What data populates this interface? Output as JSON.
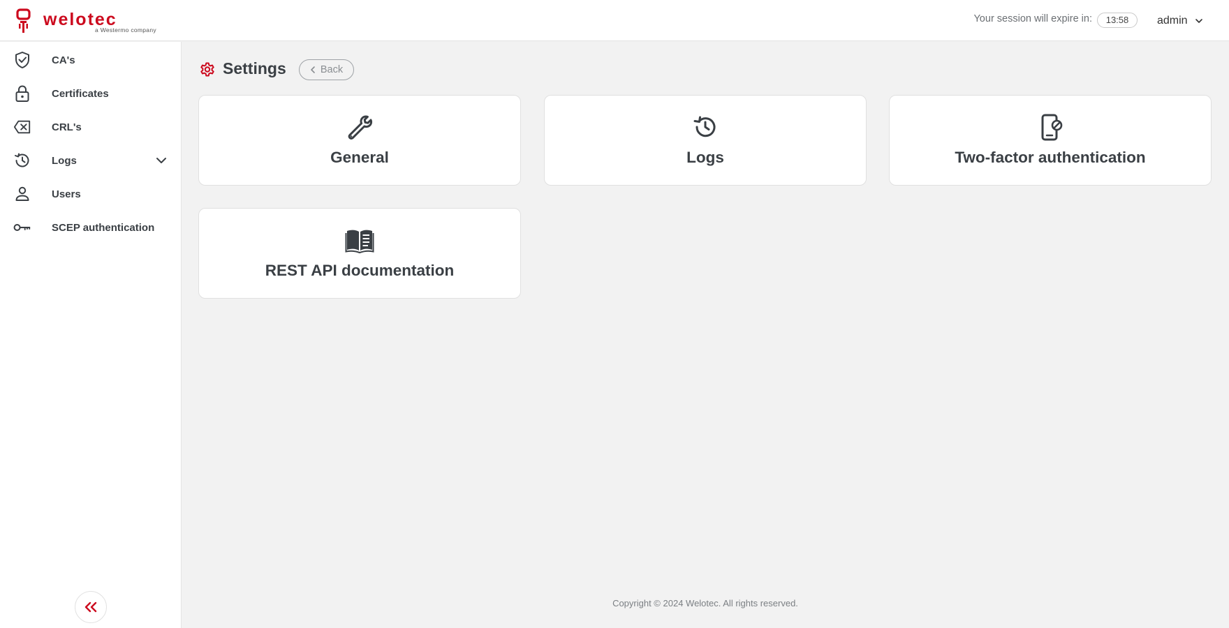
{
  "brand": {
    "name": "welotec",
    "tagline": "a Westermo company",
    "color": "#cc0a1e"
  },
  "header": {
    "session_label": "Your session will expire in:",
    "session_time": "13:58",
    "user": "admin"
  },
  "sidebar": {
    "items": [
      {
        "label": "CA's",
        "icon": "shield-check-icon"
      },
      {
        "label": "Certificates",
        "icon": "lock-icon"
      },
      {
        "label": "CRL's",
        "icon": "backspace-x-icon"
      },
      {
        "label": "Logs",
        "icon": "history-icon",
        "expandable": true
      },
      {
        "label": "Users",
        "icon": "user-icon"
      },
      {
        "label": "SCEP authentication",
        "icon": "key-icon"
      }
    ],
    "collapse_icon": "double-chevron-left-icon"
  },
  "page": {
    "title": "Settings",
    "title_icon": "gear-icon",
    "back_label": "Back"
  },
  "cards": [
    {
      "label": "General",
      "icon": "wrench-icon"
    },
    {
      "label": "Logs",
      "icon": "history-icon"
    },
    {
      "label": "Two-factor authentication",
      "icon": "mobile-blocked-icon"
    },
    {
      "label": "REST API documentation",
      "icon": "open-book-icon"
    }
  ],
  "footer": {
    "copyright": "Copyright © 2024 Welotec. All rights reserved."
  }
}
